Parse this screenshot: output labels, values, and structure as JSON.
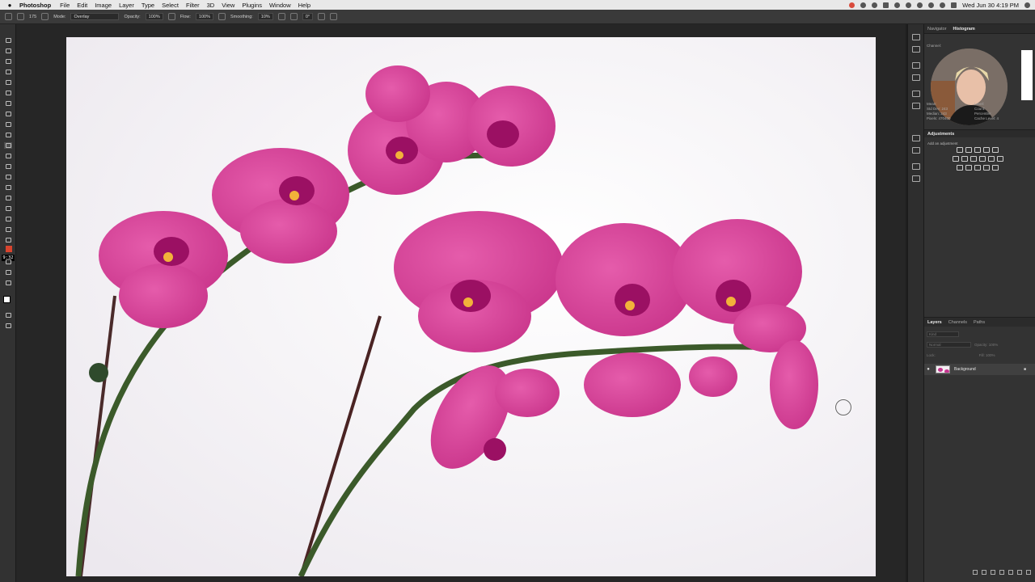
{
  "menubar": {
    "app": "Photoshop",
    "items": [
      "File",
      "Edit",
      "Image",
      "Layer",
      "Type",
      "Select",
      "Filter",
      "3D",
      "View",
      "Plugins",
      "Window",
      "Help"
    ],
    "clock": "Wed Jun 30  4:19 PM"
  },
  "options": {
    "brush_size": "175",
    "mode_label": "Mode:",
    "mode_value": "Overlay",
    "opacity_label": "Opacity:",
    "opacity_value": "100%",
    "flow_label": "Flow:",
    "flow_value": "100%",
    "smoothing_label": "Smoothing:",
    "smoothing_value": "10%",
    "angle_value": "0°"
  },
  "toolbar": {
    "timer": "9:32"
  },
  "histogram_panel": {
    "tabs": [
      "Navigator",
      "Histogram"
    ],
    "active_tab": "Histogram",
    "channel_label": "Channel:",
    "stats_left": [
      "Mean:",
      "Std Dev:  243",
      "Median:  243",
      "Pixels:  470400"
    ],
    "stats_right": [
      "Level:",
      "Count:",
      "Percentile:",
      "Cache Level:  4"
    ]
  },
  "adjustments_panel": {
    "title": "Adjustments",
    "subtitle": "Add an adjustment"
  },
  "layers_panel": {
    "tabs": [
      "Layers",
      "Channels",
      "Paths"
    ],
    "active_tab": "Layers",
    "filter_placeholder": "Kind",
    "blend_mode": "Normal",
    "opacity_label": "Opacity: 100%",
    "lock_label": "Lock:",
    "fill_label": "Fill: 100%",
    "layer_name": "Background"
  },
  "colors": {
    "orchid_petal": "#d9469b",
    "orchid_dark": "#9b1063",
    "stem": "#3b5a2a",
    "canvas_bg": "#f7f4f6"
  }
}
